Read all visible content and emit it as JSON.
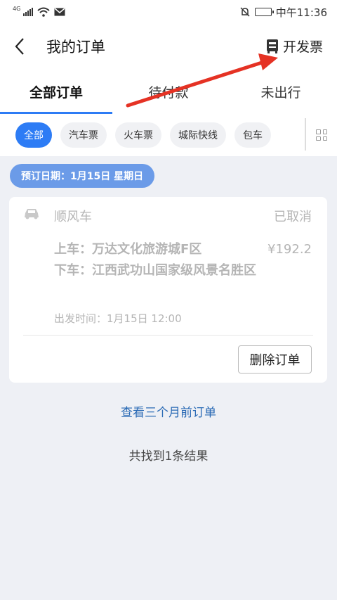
{
  "status_bar": {
    "network": "4G",
    "time": "中午11:36",
    "colors": {
      "text": "#333333"
    }
  },
  "header": {
    "title": "我的订单",
    "invoice_label": "开发票"
  },
  "tabs": [
    {
      "label": "全部订单",
      "active": true
    },
    {
      "label": "待付款",
      "active": false
    },
    {
      "label": "未出行",
      "active": false
    }
  ],
  "filters": [
    {
      "label": "全部",
      "active": true
    },
    {
      "label": "汽车票",
      "active": false
    },
    {
      "label": "火车票",
      "active": false
    },
    {
      "label": "城际快线",
      "active": false
    },
    {
      "label": "包车",
      "active": false
    }
  ],
  "date_pill": "预订日期：1月15日 星期日",
  "order": {
    "service": "顺风车",
    "status": "已取消",
    "pickup": "上车：万达文化旅游城F区",
    "dropoff": "下车：江西武功山国家级风景名胜区",
    "price": "¥192.2",
    "depart_time": "出发时间：1月15日 12:00",
    "delete_label": "删除订单"
  },
  "older_link": "查看三个月前订单",
  "result_count": "共找到1条结果",
  "colors": {
    "accent": "#2d7cf5",
    "date_pill": "#6b9be8",
    "link": "#2a6ab5",
    "annotation_arrow": "#e53224"
  },
  "icons": {
    "back": "chevron-left-icon",
    "invoice": "invoice-icon",
    "car": "car-icon",
    "grid": "grid-icon"
  }
}
